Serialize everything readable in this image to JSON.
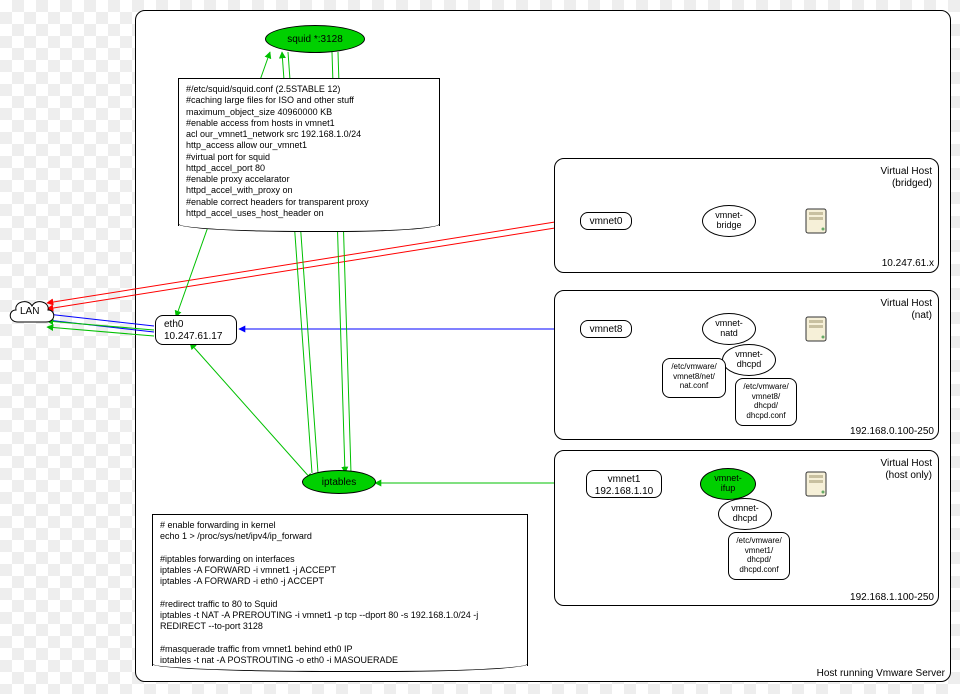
{
  "main_frame_label": "Host running Vmware Server",
  "lan_label": "LAN",
  "eth0": {
    "name": "eth0",
    "ip": "10.247.61.17"
  },
  "squid": "squid *:3128",
  "iptables": "iptables",
  "squid_conf": "#/etc/squid/squid.conf (2.5STABLE 12)\n#caching large files for ISO and other stuff\nmaximum_object_size 40960000 KB\n#enable access from hosts in vmnet1\nacl our_vmnet1_network src 192.168.1.0/24\nhttp_access allow our_vmnet1\n#virtual port for squid\nhttpd_accel_port 80\n#enable proxy accelarator\nhttpd_accel_with_proxy on\n#enable correct headers for transparent proxy\nhttpd_accel_uses_host_header on",
  "iptables_conf": "# enable forwarding in kernel\necho 1 > /proc/sys/net/ipv4/ip_forward\n\n#iptables forwarding on interfaces\niptables -A FORWARD -i vmnet1 -j ACCEPT\niptables -A FORWARD -i eth0 -j ACCEPT\n\n#redirect traffic to 80 to Squid\niptables -t NAT -A PREROUTING -i vmnet1 -p tcp --dport 80 -s 192.168.1.0/24 -j\nREDIRECT --to-port 3128\n\n#masquerade traffic from vmnet1 behind eth0 IP\niptables -t nat -A POSTROUTING -o eth0 -j MASQUERADE",
  "bridged": {
    "title_l1": "Virtual Host",
    "title_l2": "(bridged)",
    "subnet": "10.247.61.x",
    "vmnet": "vmnet0",
    "bridge": "vmnet-\nbridge"
  },
  "nat": {
    "title_l1": "Virtual Host",
    "title_l2": "(nat)",
    "subnet": "192.168.0.100-250",
    "vmnet": "vmnet8",
    "natd": "vmnet-\nnatd",
    "dhcpd": "vmnet-\ndhcpd",
    "natconf": "/etc/vmware/\nvmnet8/net/\nnat.conf",
    "dhcpconf": "/etc/vmware/\nvmnet8/\ndhcpd/\ndhcpd.conf"
  },
  "hostonly": {
    "title_l1": "Virtual Host",
    "title_l2": "(host only)",
    "subnet": "192.168.1.100-250",
    "vmnet_l1": "vmnet1",
    "vmnet_l2": "192.168.1.10",
    "ifup": "vmnet-\nifup",
    "dhcpd": "vmnet-\ndhcpd",
    "dhcpconf": "/etc/vmware/\nvmnet1/\ndhcpd/\ndhcpd.conf"
  }
}
